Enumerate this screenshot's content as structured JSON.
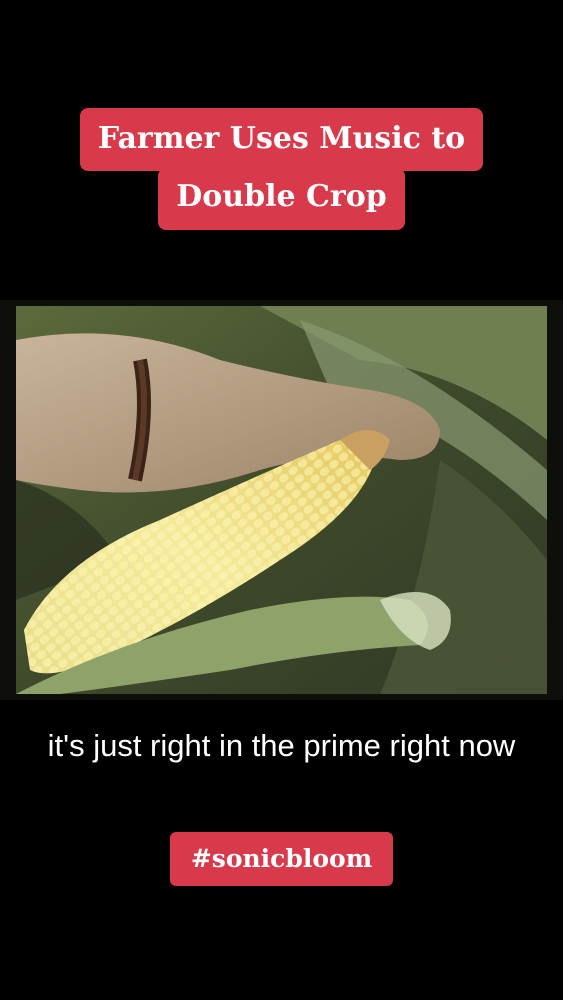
{
  "title": {
    "line1": "Farmer Uses Music to",
    "line2": "Double Crop"
  },
  "video": {
    "caption": "it's just right in the prime right now"
  },
  "hashtag": "#sonicbloom",
  "colors": {
    "background": "#000000",
    "label_red": "#d83a4b",
    "text": "#ffffff"
  }
}
